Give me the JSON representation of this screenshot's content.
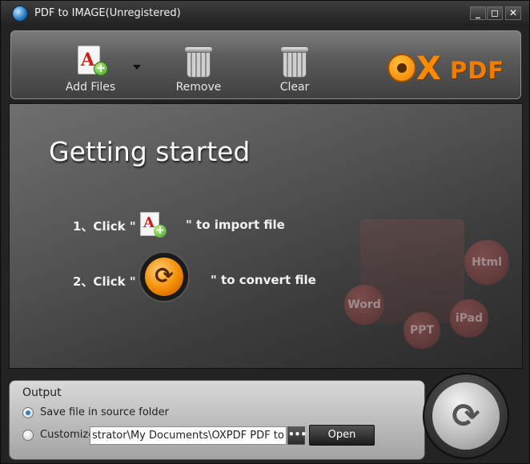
{
  "window": {
    "title": "PDF to IMAGE(Unregistered)",
    "buttons": {
      "minimize": "_",
      "maximize": "◻",
      "close": "✕"
    }
  },
  "toolbar": {
    "add_files_label": "Add Files",
    "remove_label": "Remove",
    "clear_label": "Clear",
    "logo_x": "X",
    "logo_pdf": "PDF"
  },
  "main": {
    "heading": "Getting started",
    "step1_prefix": "1、Click \"",
    "step1_suffix": "\" to import file",
    "step2_prefix": "2、Click \"",
    "step2_suffix": "\" to convert file",
    "watermark": {
      "html": "Html",
      "word": "Word",
      "ppt": "PPT",
      "ipad": "iPad"
    }
  },
  "output": {
    "label": "Output",
    "option_source": "Save file in source folder",
    "option_customize": "Customize",
    "selected": "source",
    "path_value": "strator\\My Documents\\OXPDF PDF to Image",
    "browse_label": "•••",
    "open_label": "Open"
  },
  "colors": {
    "accent": "#f28b00",
    "toolbar": "#5b5b5b"
  }
}
